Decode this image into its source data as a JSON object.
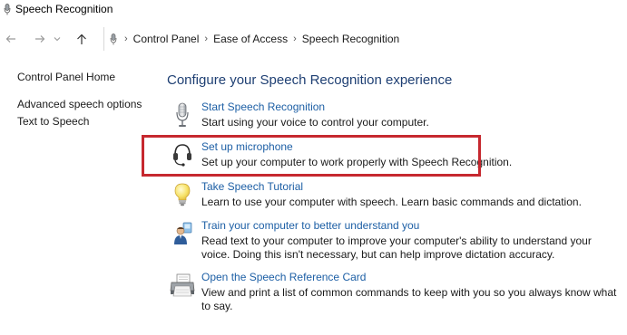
{
  "window": {
    "title": "Speech Recognition"
  },
  "breadcrumb": [
    "Control Panel",
    "Ease of Access",
    "Speech Recognition"
  ],
  "sidebar": {
    "home": "Control Panel Home",
    "items": [
      "Advanced speech options",
      "Text to Speech"
    ]
  },
  "main": {
    "title": "Configure your Speech Recognition experience",
    "tasks": [
      {
        "link": "Start Speech Recognition",
        "desc": "Start using your voice to control your computer.",
        "icon": "microphone-icon"
      },
      {
        "link": "Set up microphone",
        "desc": "Set up your computer to work properly with Speech Recognition.",
        "icon": "headset-icon"
      },
      {
        "link": "Take Speech Tutorial",
        "desc": "Learn to use your computer with speech.  Learn basic commands and dictation.",
        "icon": "lightbulb-icon"
      },
      {
        "link": "Train your computer to better understand you",
        "desc": "Read text to your computer to improve your computer's ability to understand your voice.  Doing this isn't necessary, but can help improve dictation accuracy.",
        "icon": "user-training-icon"
      },
      {
        "link": "Open the Speech Reference Card",
        "desc": "View and print a list of common commands to keep with you so you always know what to say.",
        "icon": "printer-icon"
      }
    ]
  },
  "colors": {
    "link": "#1d5fa5",
    "heading": "#1e3f73",
    "highlight": "#c6282f"
  }
}
